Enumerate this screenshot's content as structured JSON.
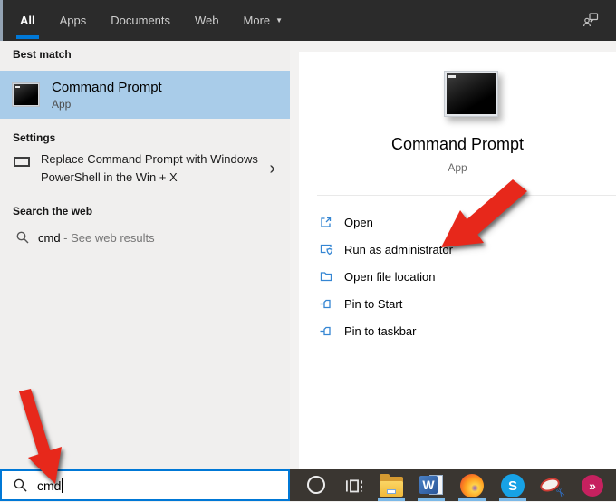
{
  "header": {
    "tabs": [
      {
        "label": "All",
        "selected": true
      },
      {
        "label": "Apps",
        "selected": false
      },
      {
        "label": "Documents",
        "selected": false
      },
      {
        "label": "Web",
        "selected": false
      },
      {
        "label": "More",
        "selected": false,
        "dropdown_glyph": "▼"
      }
    ],
    "feedback_icon": "feedback-icon"
  },
  "left_panel": {
    "best_match": {
      "header": "Best match",
      "item": {
        "title": "Command Prompt",
        "subtitle": "App",
        "icon": "command-prompt-icon"
      }
    },
    "settings": {
      "header": "Settings",
      "item": {
        "label": "Replace Command Prompt with Windows PowerShell in the Win + X",
        "chevron": "›",
        "icon": "window-rectangle-icon"
      }
    },
    "web": {
      "header": "Search the web",
      "item": {
        "query": "cmd",
        "suffix": " - See web results",
        "icon": "search-icon"
      }
    }
  },
  "right_panel": {
    "title": "Command Prompt",
    "subtitle": "App",
    "icon": "command-prompt-icon",
    "actions": [
      {
        "label": "Open",
        "icon": "open-icon"
      },
      {
        "label": "Run as administrator",
        "icon": "run-as-administrator-icon"
      },
      {
        "label": "Open file location",
        "icon": "open-file-location-icon"
      },
      {
        "label": "Pin to Start",
        "icon": "pin-icon"
      },
      {
        "label": "Pin to taskbar",
        "icon": "pin-icon"
      }
    ]
  },
  "search_box": {
    "value": "cmd",
    "icon": "search-icon"
  },
  "taskbar": {
    "icons": [
      {
        "name": "cortana-icon",
        "running": false
      },
      {
        "name": "task-view-icon",
        "running": false
      },
      {
        "name": "file-explorer-icon",
        "running": true
      },
      {
        "name": "word-icon",
        "running": true,
        "letter": "W"
      },
      {
        "name": "firefox-icon",
        "running": true
      },
      {
        "name": "skype-icon",
        "running": true,
        "letter": "S"
      },
      {
        "name": "screen-clip-icon",
        "running": false,
        "glyph": "✂"
      },
      {
        "name": "pink-app-icon",
        "running": false,
        "glyph": "»"
      }
    ]
  },
  "annotations": {
    "arrow_color": "#e7281b",
    "arrows": [
      {
        "points_to": "run-as-administrator"
      },
      {
        "points_to": "search-input"
      }
    ]
  },
  "colors": {
    "accent": "#0078d7",
    "highlight_row": "#a9cce9",
    "header_bg": "#2b2b2b",
    "taskbar_bg": "#3a3631",
    "running_underline": "#7cb9e8",
    "action_icon_blue": "#3586d3"
  }
}
